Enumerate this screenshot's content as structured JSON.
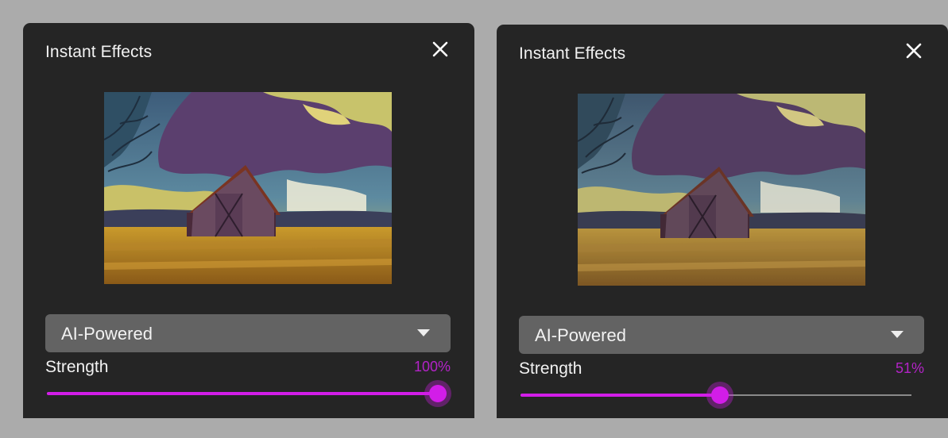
{
  "accent_color": "#d21de8",
  "panels": [
    {
      "title": "Instant Effects",
      "close_icon": "close-icon",
      "preview": {
        "description": "painterly barn effect preview"
      },
      "dropdown": {
        "selected": "AI-Powered",
        "icon": "chevron-down-icon"
      },
      "strength": {
        "label": "Strength",
        "value_text": "100%",
        "value": 1.0
      }
    },
    {
      "title": "Instant Effects",
      "close_icon": "close-icon",
      "preview": {
        "description": "painterly barn effect preview"
      },
      "dropdown": {
        "selected": "AI-Powered",
        "icon": "chevron-down-icon"
      },
      "strength": {
        "label": "Strength",
        "value_text": "51%",
        "value": 0.51
      }
    }
  ]
}
